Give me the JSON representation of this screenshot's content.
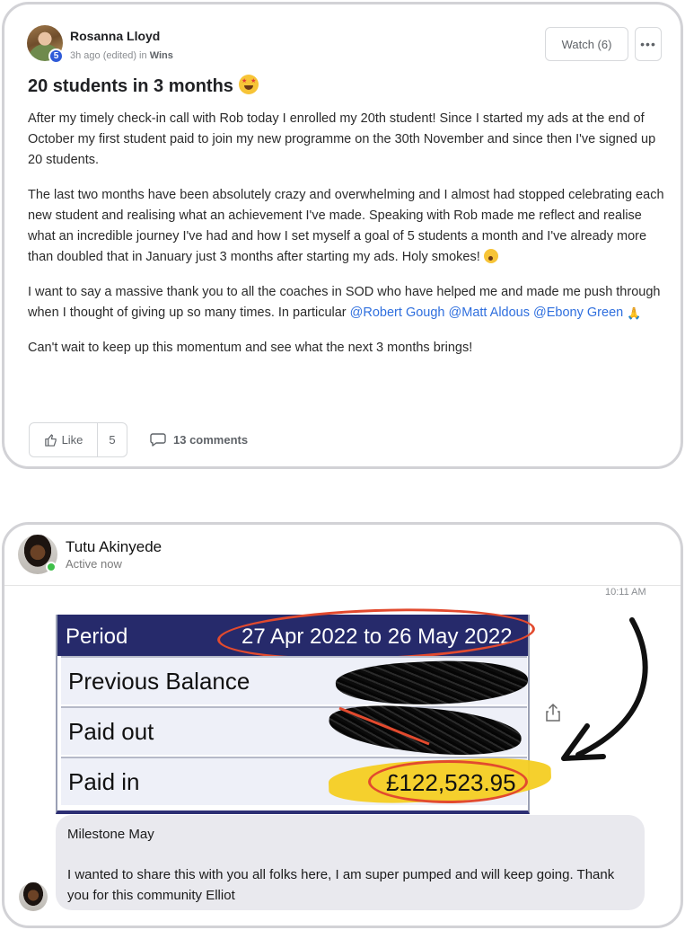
{
  "post": {
    "author": "Rosanna Lloyd",
    "level": "5",
    "meta_time": "3h ago (edited) in",
    "category": "Wins",
    "watch_label": "Watch (6)",
    "more_label": "•••",
    "title": "20 students in 3 months",
    "paragraph1": "After my timely check-in call with Rob today I enrolled my 20th student! Since I started my ads at the end of October my first student paid to join my new programme on the 30th November and since then I've signed up 20 students.",
    "paragraph2": "The last two months have been absolutely crazy and overwhelming and I almost had stopped celebrating each new student and realising what an achievement I've made. Speaking with Rob made me reflect and realise what an incredible journey I've had and how I set myself a goal of 5 students a month and I've already more than doubled that in January just 3 months after starting my ads. Holy smokes!",
    "paragraph3_text": "I want to say a massive thank you to all the coaches in SOD who have helped me and made me push through when I thought of giving up so many times. In particular",
    "mention1": "@Robert Gough",
    "mention2": "@Matt Aldous",
    "mention3": "@Ebony Green",
    "paragraph4": "Can't wait to keep up this momentum and see what the next 3 months brings!",
    "like_label": "Like",
    "like_count": "5",
    "comments_label": "13 comments"
  },
  "message": {
    "contact_name": "Tutu Akinyede",
    "contact_status": "Active now",
    "time": "10:11 AM",
    "statement": {
      "period_label": "Period",
      "period_value": "27 Apr 2022 to 26 May 2022",
      "rows": [
        {
          "label": "Previous Balance",
          "value": ""
        },
        {
          "label": "Paid out",
          "value": ""
        },
        {
          "label": "Paid in",
          "value": "£122,523.95"
        }
      ]
    },
    "bubble_line1": "Milestone May",
    "bubble_line2": "I wanted to share this with you all folks here, I am super pumped and will keep going. Thank you for this community Elliot"
  },
  "colors": {
    "mention": "#2f6fde",
    "statement_header": "#262a6b",
    "online": "#3fbf4a",
    "level_badge": "#2f5bd8",
    "highlight": "#f4cd22",
    "annotation_red": "#e24a2e"
  },
  "icons": [
    "thumbs-up-icon",
    "comment-icon",
    "share-icon",
    "more-icon",
    "arrow-annotation-icon"
  ]
}
